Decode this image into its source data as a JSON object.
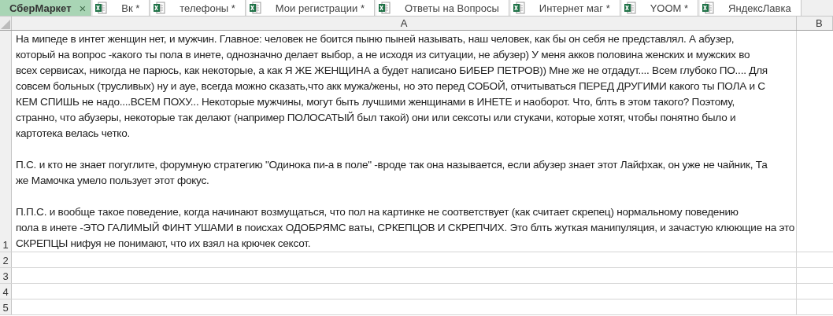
{
  "sheet_tabs": [
    {
      "label": "СберМаркет",
      "selected": true
    },
    {
      "label": "Вк *",
      "selected": false
    },
    {
      "label": "телефоны *",
      "selected": false
    },
    {
      "label": "Мои регистрации *",
      "selected": false
    },
    {
      "label": "Ответы на Вопросы",
      "selected": false
    },
    {
      "label": "Интернет маг *",
      "selected": false
    },
    {
      "label": "YOOM *",
      "selected": false
    },
    {
      "label": "ЯндексЛавка",
      "selected": false
    }
  ],
  "close_glyph": "×",
  "columns": [
    "A",
    "B"
  ],
  "rows": [
    {
      "number": "1",
      "cell_a": [
        [
          "На мипеде в интет женщин нет, и мужчин. Главное: человек не боится пыню пыней называть, наш человек, как бы он себя не представлял. А абузер,",
          "который на вопрос -какого ты пола в инете, однозначно делает выбор, а не исходя из ситуации, не абузер) У меня акков половина женских и мужских во",
          "всех сервисах, никогда не парюсь, как некоторые, а как Я ЖЕ ЖЕНЩИНА а будет написано БИБЕР ПЕТРОВ)) Мне же не отдадут.... Всем глубоко ПО.... Для",
          "совсем больных (трусливых)  ну и ауе, всегда можно сказать,что акк мужа/жены, но это перед СОБОЙ, отчитываться ПЕРЕД ДРУГИМИ какого ты ПОЛА и С",
          "КЕМ СПИШЬ не надо....ВСЕМ ПОХУ... Некоторые мужчины, могут быть лучшими женщинами в ИНЕТЕ и наоборот. Что, блть в этом такого? Поэтому,",
          "странно, что абузеры, некоторые так делают (например ПОЛОСАТЫЙ был такой) они или сексоты или стукачи, которые хотят, чтобы понятно было и",
          "картотека велась четко."
        ],
        [
          "П.С. и кто не знает погуглите, форумную стратегию \"Одинока пи-а в поле\" -вроде так она называется, если абузер знает этот Лайфхак, он уже не чайник, Та",
          "же Мамочка умело пользует этот фокус."
        ],
        [
          "П.П.С. и вообще такое поведение, когда начинают возмущаться, что пол на картинке не соответствует (как считает скрепец) нормальному поведению",
          "пола в инете -ЭТО ГАЛИМЫЙ ФИНТ УШАМИ в поисхах ОДОБРЯМС ваты, СРКЕПЦОВ И СКРЕПЧИХ. Это блть жуткая манипуляция, и зачастую клюющие на это",
          "СКРЕПЦЫ нифуя не понимают, что их взял на крючек сексот."
        ]
      ]
    },
    {
      "number": "2"
    },
    {
      "number": "3"
    },
    {
      "number": "4"
    },
    {
      "number": "5"
    }
  ]
}
